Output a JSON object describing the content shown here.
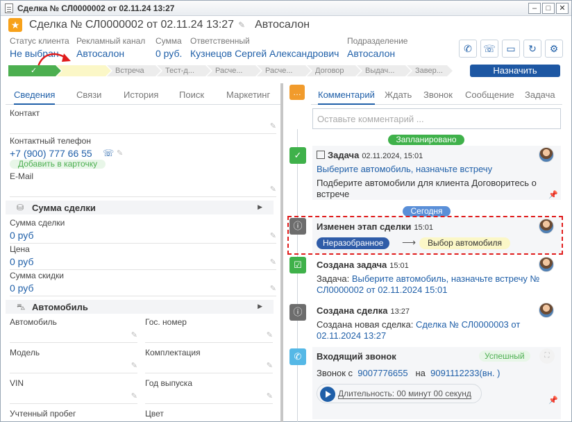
{
  "window": {
    "title": "Сделка № СЛ0000002 от 02.11.24 13:27"
  },
  "header": {
    "title": "Сделка № СЛ0000002 от 02.11.24 13:27",
    "subtitle": "Автосалон"
  },
  "fields": [
    {
      "label": "Статус клиента",
      "value": "Не выбран"
    },
    {
      "label": "Рекламный канал",
      "value": "Автосалон"
    },
    {
      "label": "Сумма",
      "value": "0 руб."
    },
    {
      "label": "Ответственный",
      "value": "Кузнецов Сергей Александрович"
    },
    {
      "label": "Подразделение",
      "value": "Автосалон"
    }
  ],
  "stages": [
    "",
    "",
    "Встреча",
    "Тест-д...",
    "Расче...",
    "Расче...",
    "Договор",
    "Выдач...",
    "Завер..."
  ],
  "assign_button": "Назначить",
  "left_tabs": [
    "Сведения",
    "Связи",
    "История",
    "Поиск",
    "Маркетинг"
  ],
  "left": {
    "contact_label": "Контакт",
    "phone_label": "Контактный телефон",
    "phone_value": "+7 (900) 777 66 55",
    "add_card": "Добавить в карточку",
    "email_label": "E-Mail",
    "sum_section": "Сумма сделки",
    "sum_label": "Сумма сделки",
    "sum_value": "0 руб",
    "price_label": "Цена",
    "price_value": "0 руб",
    "discount_label": "Сумма скидки",
    "discount_value": "0 руб",
    "car_section": "Автомобиль",
    "car_label": "Автомобиль",
    "plate_label": "Гос. номер",
    "model_label": "Модель",
    "equip_label": "Комплектация",
    "vin_label": "VIN",
    "year_label": "Год выпуска",
    "mileage_label": "Учтенный пробег",
    "color_label": "Цвет"
  },
  "right_tabs": [
    "Комментарий",
    "Ждать",
    "Звонок",
    "Сообщение",
    "Задача"
  ],
  "comment_placeholder": "Оставьте комментарий ...",
  "timeline": {
    "planned_label": "Запланировано",
    "today_label": "Сегодня",
    "task": {
      "title": "Задача",
      "time": "02.11.2024, 15:01",
      "link": "Выберите автомобиль, назначьте встречу",
      "text": "Подберите автомобили для клиента Договоритесь о встрече"
    },
    "stage_change": {
      "title": "Изменен этап сделки",
      "time": "15:01",
      "from": "Неразобранное",
      "arrow": "⟶",
      "to": "Выбор автомобиля"
    },
    "task_created": {
      "title": "Создана задача",
      "time": "15:01",
      "prefix": "Задача:",
      "link": "Выберите автомобиль, назначьте встречу № СЛ0000002 от 02.11.2024 15:01"
    },
    "deal_created": {
      "title": "Создана сделка",
      "time": "13:27",
      "prefix": "Создана новая сделка:",
      "link": "Сделка № СЛ0000003 от 02.11.2024 13:27"
    },
    "call": {
      "title": "Входящий звонок",
      "status": "Успешный",
      "from_label": "Звонок с",
      "from": "9007776655",
      "to_label": "на",
      "to": "9091112233(вн. )",
      "duration": "Длительность: 00 минут 00 секунд"
    }
  },
  "colors": {
    "accent": "#1f5fa8",
    "done_stage": "#4caf50",
    "current_stage": "#fbf7c7",
    "highlight_border": "#e01b1b",
    "planned_pill": "#3fb14a",
    "today_pill": "#5a8fd8"
  }
}
